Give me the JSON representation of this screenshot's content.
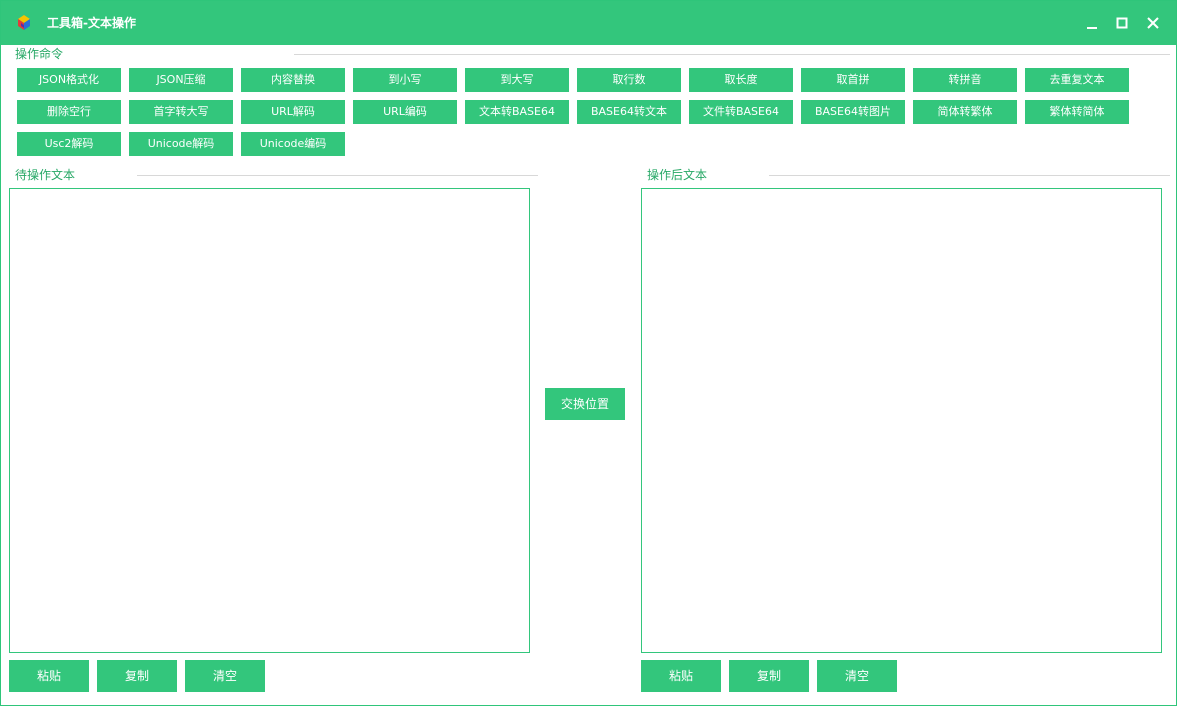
{
  "window": {
    "title": "工具箱-文本操作",
    "accent": "#33c67c"
  },
  "commands": {
    "label": "操作命令",
    "buttons": [
      "JSON格式化",
      "JSON压缩",
      "内容替换",
      "到小写",
      "到大写",
      "取行数",
      "取长度",
      "取首拼",
      "转拼音",
      "去重复文本",
      "删除空行",
      "首字转大写",
      "URL解码",
      "URL编码",
      "文本转BASE64",
      "BASE64转文本",
      "文件转BASE64",
      "BASE64转图片",
      "简体转繁体",
      "繁体转简体",
      "Usc2解码",
      "Unicode解码",
      "Unicode编码"
    ]
  },
  "source": {
    "label": "待操作文本",
    "value": "",
    "paste": "粘贴",
    "copy": "复制",
    "clear": "清空"
  },
  "target": {
    "label": "操作后文本",
    "value": "",
    "paste": "粘贴",
    "copy": "复制",
    "clear": "清空"
  },
  "swap_label": "交换位置"
}
